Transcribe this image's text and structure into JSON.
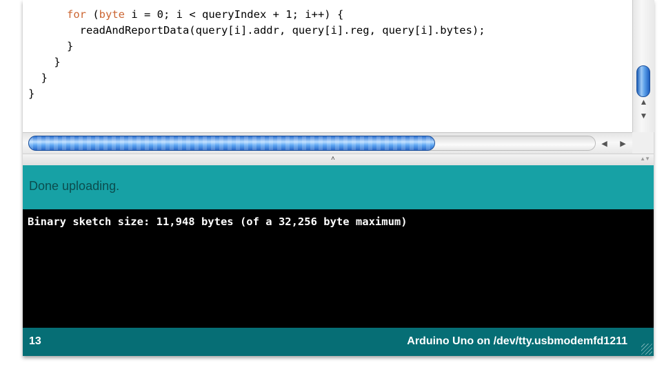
{
  "editor": {
    "code_lines": [
      {
        "indent": "      ",
        "kw": "for",
        "open": " (",
        "type": "byte",
        "rest": " i = 0; i < queryIndex + 1; i++) {"
      },
      {
        "indent": "        ",
        "kw": "",
        "open": "",
        "type": "",
        "rest": "readAndReportData(query[i].addr, query[i].reg, query[i].bytes);"
      },
      {
        "indent": "      ",
        "kw": "",
        "open": "",
        "type": "",
        "rest": "}"
      },
      {
        "indent": "    ",
        "kw": "",
        "open": "",
        "type": "",
        "rest": "}"
      },
      {
        "indent": "  ",
        "kw": "",
        "open": "",
        "type": "",
        "rest": "}"
      },
      {
        "indent": "",
        "kw": "",
        "open": "",
        "type": "",
        "rest": "}"
      }
    ],
    "keyword_color": "#cc6633"
  },
  "scrollbars": {
    "vertical": {
      "up_arrow": "▲",
      "down_arrow": "▼",
      "position": 0.9
    },
    "horizontal": {
      "left_arrow": "◀",
      "right_arrow": "▶",
      "position": 0.0
    }
  },
  "divider": {
    "grip_icon": "˄",
    "collapse_icon": "▲▼"
  },
  "status": {
    "message": "Done uploading.",
    "color": "#17a1a5"
  },
  "console": {
    "output": "Binary sketch size: 11,948 bytes (of a 32,256 byte maximum)"
  },
  "footer": {
    "line_number": "13",
    "board_port": "Arduino Uno on /dev/tty.usbmodemfd1211",
    "color": "#066e75"
  }
}
